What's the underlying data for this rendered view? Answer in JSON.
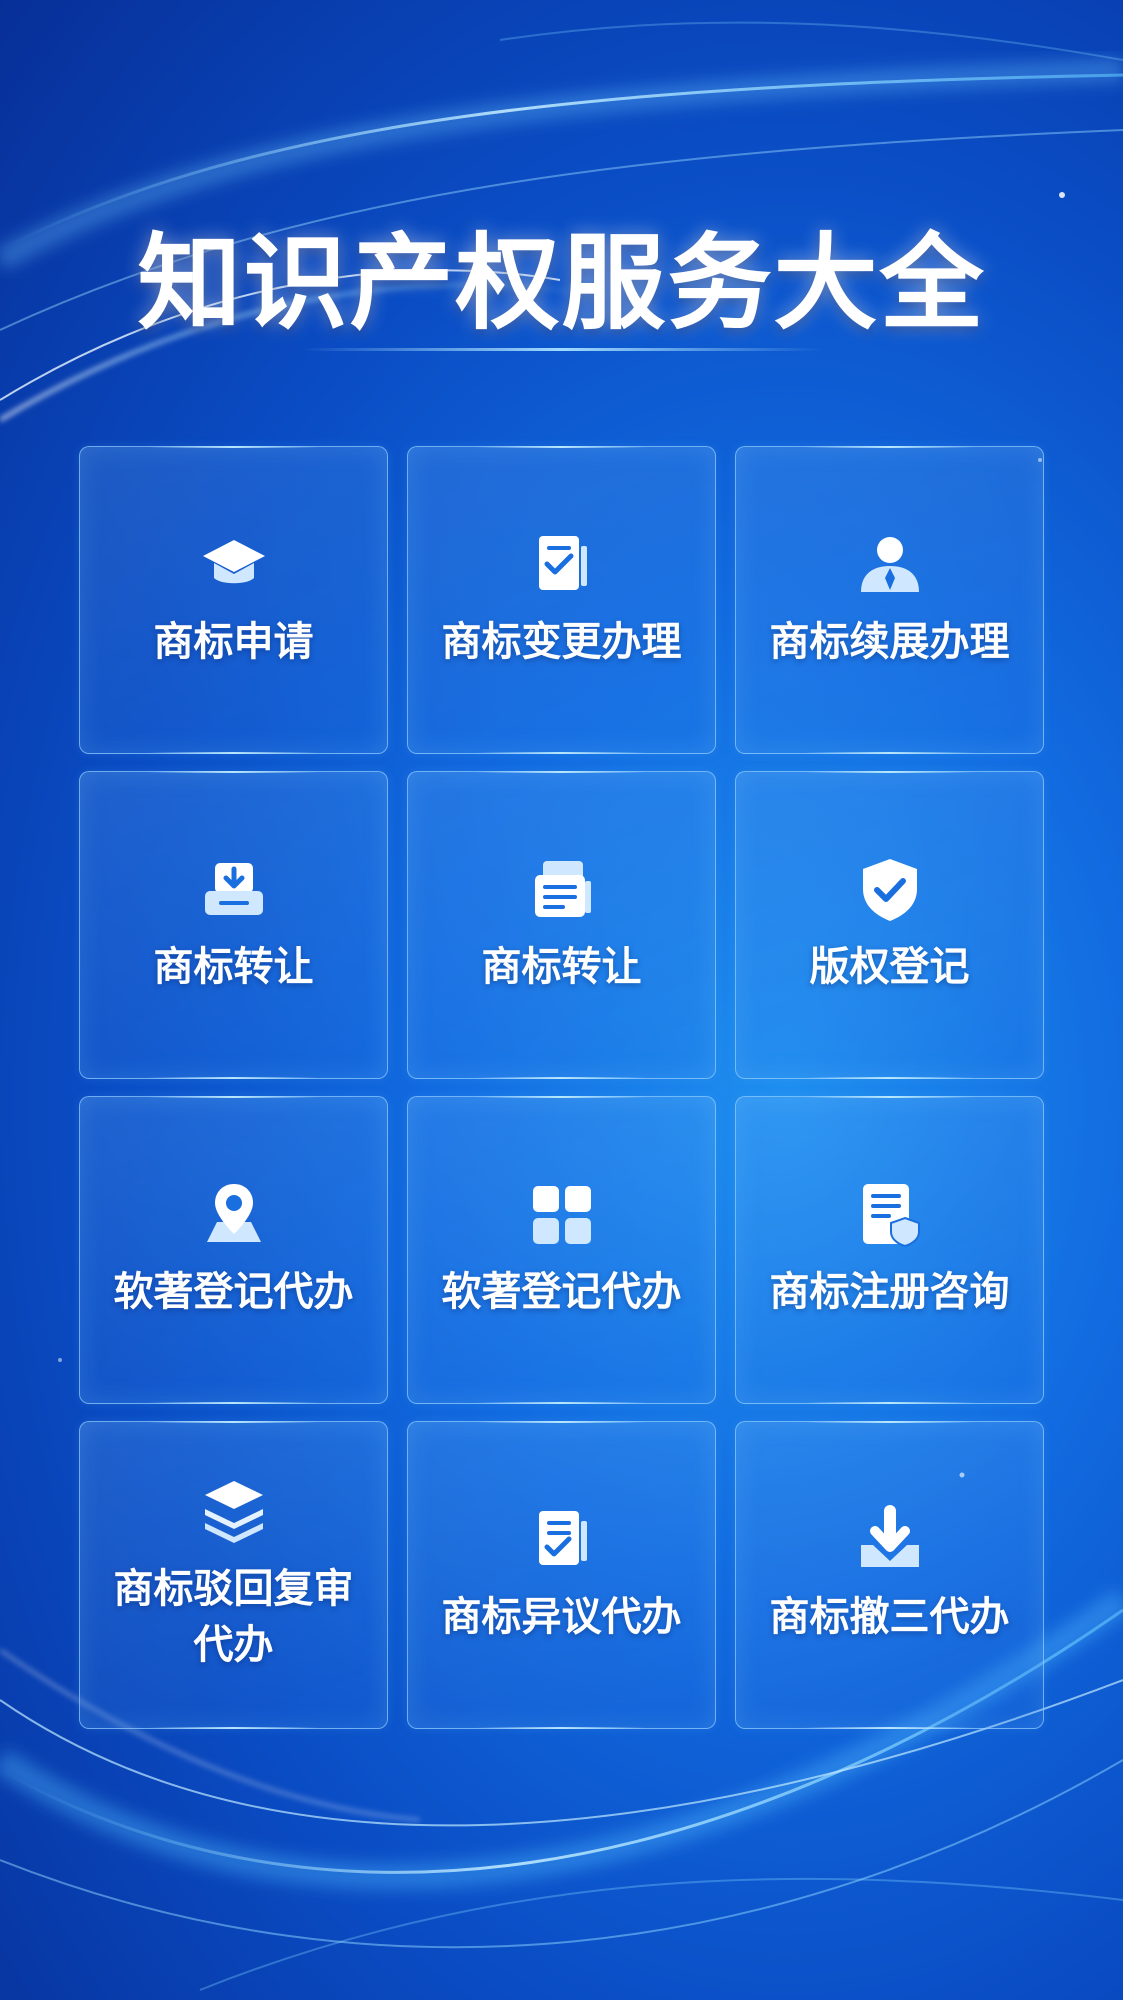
{
  "title": "知识产权服务大全",
  "services": [
    {
      "label": "商标申请",
      "icon": "graduation-cap-icon"
    },
    {
      "label": "商标变更办理",
      "icon": "document-check-icon"
    },
    {
      "label": "商标续展办理",
      "icon": "person-icon"
    },
    {
      "label": "商标转让",
      "icon": "inbox-download-icon"
    },
    {
      "label": "商标转让",
      "icon": "document-stack-icon"
    },
    {
      "label": "版权登记",
      "icon": "shield-check-icon"
    },
    {
      "label": "软著登记代办",
      "icon": "location-pin-icon"
    },
    {
      "label": "软著登记代办",
      "icon": "grid-icon"
    },
    {
      "label": "商标注册咨询",
      "icon": "document-shield-icon"
    },
    {
      "label": "商标驳回复审代办",
      "icon": "layers-icon"
    },
    {
      "label": "商标异议代办",
      "icon": "document-check-icon"
    },
    {
      "label": "商标撤三代办",
      "icon": "download-tray-icon"
    }
  ],
  "colors": {
    "background_dark": "#072f98",
    "background_mid": "#126be0",
    "background_light": "#1f8ff0",
    "card_border": "#96d2ff",
    "text": "#ffffff"
  }
}
